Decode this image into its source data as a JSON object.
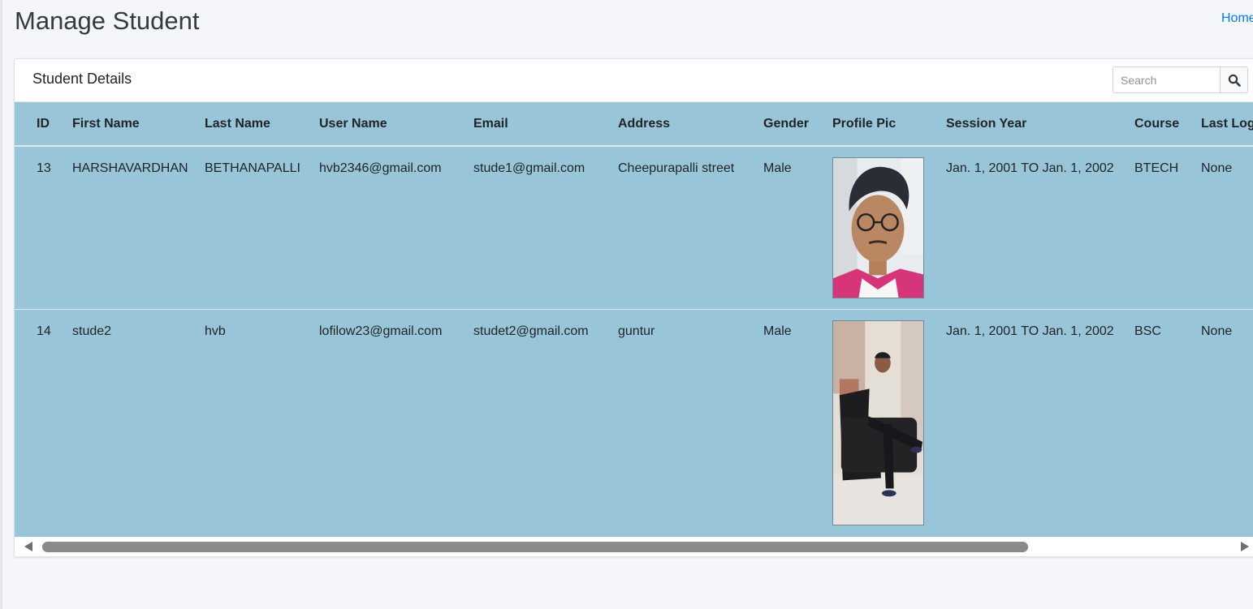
{
  "header": {
    "title": "Manage Student",
    "breadcrumb_home": "Home"
  },
  "card": {
    "title": "Student Details",
    "search": {
      "placeholder": "Search",
      "icon": "search-icon"
    }
  },
  "table": {
    "columns": [
      "ID",
      "First Name",
      "Last Name",
      "User Name",
      "Email",
      "Address",
      "Gender",
      "Profile Pic",
      "Session Year",
      "Course",
      "Last Log"
    ],
    "rows": [
      {
        "id": "13",
        "first_name": "HARSHAVARDHAN",
        "last_name": "BETHANAPALLI",
        "user_name": "hvb2346@gmail.com",
        "email": "stude1@gmail.com",
        "address": "Cheepurapalli street",
        "gender": "Male",
        "profile_pic": "photo-headshot-young-man-glasses",
        "session_year": "Jan. 1, 2001 TO Jan. 1, 2002",
        "course": "BTECH",
        "last_login": "None"
      },
      {
        "id": "14",
        "first_name": "stude2",
        "last_name": "hvb",
        "user_name": "lofilow23@gmail.com",
        "email": "studet2@gmail.com",
        "address": "guntur",
        "gender": "Male",
        "profile_pic": "photo-young-man-seated-in-black-armchair",
        "session_year": "Jan. 1, 2001 TO Jan. 1, 2002",
        "course": "BSC",
        "last_login": "None"
      }
    ]
  },
  "colors": {
    "page_bg": "#f4f6f9",
    "table_bg": "#98c6d8",
    "link": "#007bff",
    "scroll_thumb": "#8a8a8a"
  }
}
